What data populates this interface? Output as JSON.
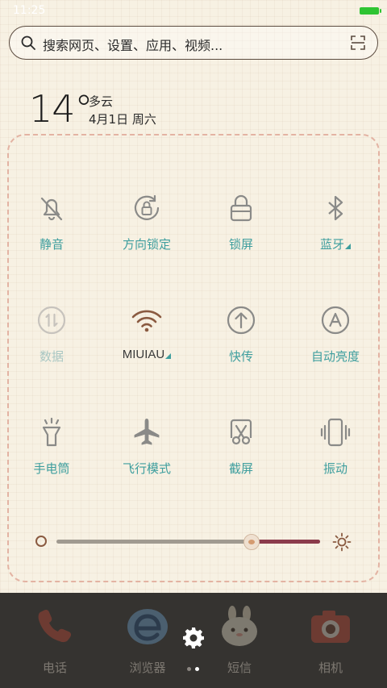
{
  "status_bar": {
    "time": "11:25"
  },
  "search": {
    "placeholder": "搜索网页、设置、应用、视频..."
  },
  "weather": {
    "temperature": "14°",
    "condition": "多云",
    "date": "4月1日 周六"
  },
  "toggles": [
    {
      "label": "静音",
      "icon": "bell-off-icon"
    },
    {
      "label": "方向锁定",
      "icon": "rotation-lock-icon"
    },
    {
      "label": "锁屏",
      "icon": "lock-icon"
    },
    {
      "label": "蓝牙",
      "icon": "bluetooth-icon"
    },
    {
      "label": "数据",
      "icon": "mobile-data-icon"
    },
    {
      "label": "MIUIAU",
      "icon": "wifi-icon"
    },
    {
      "label": "快传",
      "icon": "upload-arrow-icon"
    },
    {
      "label": "自动亮度",
      "icon": "auto-brightness-icon"
    },
    {
      "label": "手电筒",
      "icon": "flashlight-icon"
    },
    {
      "label": "飞行模式",
      "icon": "airplane-icon"
    },
    {
      "label": "截屏",
      "icon": "screenshot-icon"
    },
    {
      "label": "振动",
      "icon": "vibrate-icon"
    }
  ],
  "brightness": {
    "level": 0.74
  },
  "dock": {
    "apps": [
      {
        "label": "电话",
        "icon": "phone-icon"
      },
      {
        "label": "浏览器",
        "icon": "browser-icon"
      },
      {
        "label": "短信",
        "icon": "messages-icon"
      },
      {
        "label": "相机",
        "icon": "camera-icon"
      }
    ],
    "page_count": 2,
    "active_page": 2
  },
  "colors": {
    "accent_teal": "#3e9e9e",
    "wifi_brown": "#8a5a40",
    "brightness_fill": "#8b3b4b",
    "battery_green": "#2ec432"
  }
}
